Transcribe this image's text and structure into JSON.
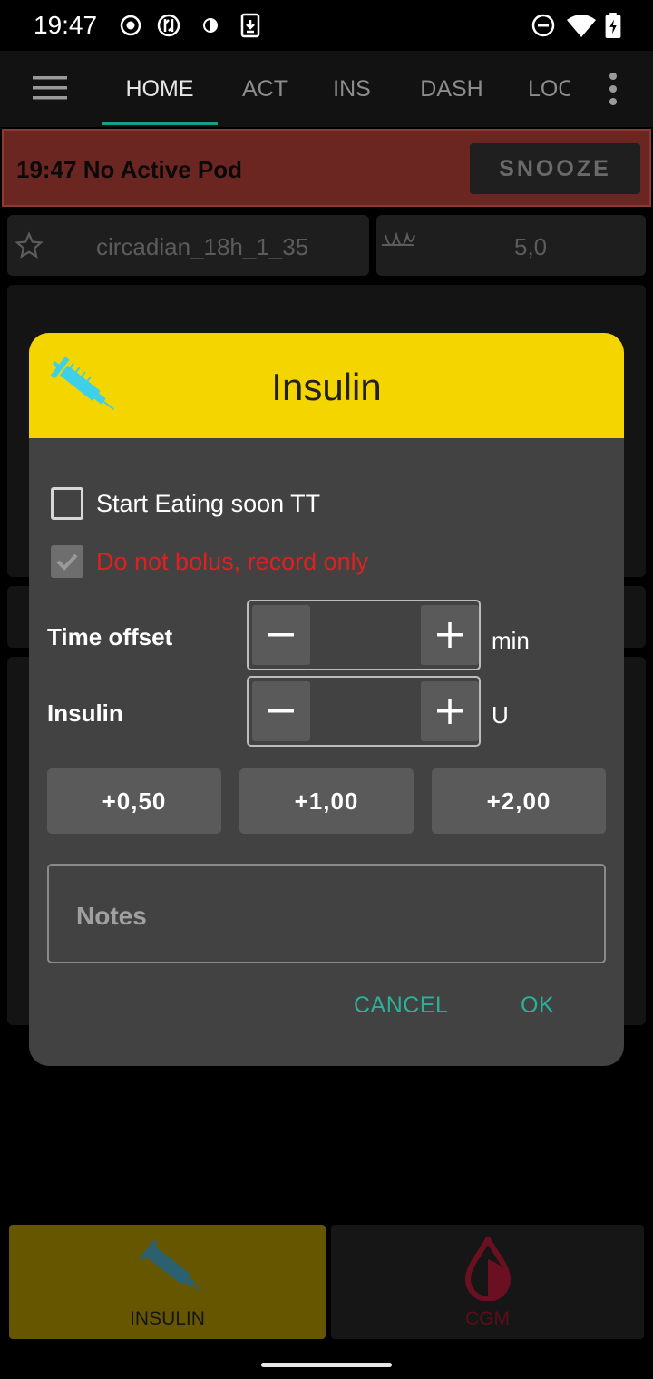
{
  "status_bar": {
    "time": "19:47",
    "icons": [
      "record-icon",
      "sync-icon",
      "contrast-icon",
      "download-icon",
      "dnd-icon",
      "wifi-icon",
      "battery-charging-icon"
    ]
  },
  "app_bar": {
    "tabs": [
      {
        "label": "HOME",
        "active": true
      },
      {
        "label": "ACT",
        "active": false
      },
      {
        "label": "INS",
        "active": false
      },
      {
        "label": "DASH",
        "active": false
      },
      {
        "label": "LOOP",
        "active": false
      }
    ]
  },
  "alarm": {
    "message": "19:47 No Active Pod",
    "snooze_label": "SNOOZE"
  },
  "profile": {
    "name": "circadian_18h_1_35",
    "target": "5,0"
  },
  "dialog": {
    "title": "Insulin",
    "start_eating_soon": {
      "label": "Start Eating soon TT",
      "checked": false
    },
    "record_only": {
      "label": "Do not bolus, record only",
      "checked": true
    },
    "time_offset": {
      "label": "Time offset",
      "unit": "min",
      "value": ""
    },
    "insulin": {
      "label": "Insulin",
      "unit": "U",
      "value": ""
    },
    "quick_buttons": [
      "+0,50",
      "+1,00",
      "+2,00"
    ],
    "notes_placeholder": "Notes",
    "cancel_label": "CANCEL",
    "ok_label": "OK"
  },
  "bottom_bar": {
    "insulin_label": "INSULIN",
    "cgm_label": "CGM"
  },
  "colors": {
    "header_yellow": "#f5d500",
    "dialog_bg": "#424242",
    "accent_teal": "#2bb09a",
    "warning_red": "#e02020",
    "alarm_bg": "#6b2621"
  }
}
